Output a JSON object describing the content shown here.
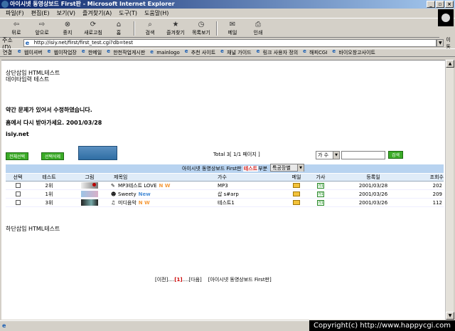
{
  "window": {
    "title": "아이시넷 동영상보드 First판 - Microsoft Internet Explorer",
    "controls": [
      "_",
      "▫",
      "×"
    ]
  },
  "menu": [
    "파일(F)",
    "편집(E)",
    "보기(V)",
    "즐겨찾기(A)",
    "도구(T)",
    "도움말(H)"
  ],
  "toolbar": {
    "buttons": [
      {
        "label": "뒤로",
        "icon": "back-arrow-icon",
        "glyph": "⇦"
      },
      {
        "label": "앞으로",
        "icon": "forward-arrow-icon",
        "glyph": "⇨"
      },
      {
        "label": "중지",
        "icon": "stop-icon",
        "glyph": "⊗"
      },
      {
        "label": "새로고침",
        "icon": "refresh-icon",
        "glyph": "⟳"
      },
      {
        "label": "홈",
        "icon": "home-icon",
        "glyph": "⌂"
      },
      {
        "label": "검색",
        "icon": "search-icon",
        "glyph": "⌕"
      },
      {
        "label": "즐겨찾기",
        "icon": "favorites-icon",
        "glyph": "★"
      },
      {
        "label": "목록보기",
        "icon": "history-icon",
        "glyph": "◷"
      },
      {
        "label": "메일",
        "icon": "mail-icon",
        "glyph": "✉"
      },
      {
        "label": "인쇄",
        "icon": "print-icon",
        "glyph": "⎙"
      }
    ]
  },
  "address": {
    "label": "주소(D)",
    "url": "http://isiy.net/first/first_test.cgi?db=test",
    "go": "이동"
  },
  "links": {
    "label": "연결",
    "items": [
      "웹이셔버",
      "웹이작업장",
      "한메일",
      "한천작업게시판",
      "mainlogo",
      "추천 사이트",
      "채널 가이드",
      "링크 사용자 정의",
      "해피CGI",
      "바이오창고사이트"
    ]
  },
  "content": {
    "top_line1": "상단삽입 HTML테스트",
    "top_line2": "데이타입력 테스트",
    "notice1": "약간 문제가 있어서 수정하였습니다.",
    "notice2": "홈에서 다시 받아가세요. 2001/03/28",
    "site": "isiy.net",
    "btn_select_all": "전체선택",
    "btn_delete": "선택삭제",
    "total": "Total 3[ 1/1 페이지 ]",
    "search_field": "가 수",
    "search_btn": "검색",
    "board_title_pre": "아이시넷 동영상보드 First판 ",
    "board_title_hl": "테스트",
    "board_title_post": "부분",
    "genre_select": "특공장별",
    "bottom_text": "하단삽입 HTML테스트"
  },
  "table": {
    "headers": [
      "선택",
      "테스트",
      "그림",
      "제목임",
      "가수",
      "메일",
      "가사",
      "등록일",
      "조회수"
    ],
    "rows": [
      {
        "rank": "2위",
        "title": "MP3테스트 LOVE",
        "tag": "N  W",
        "singer": "MP3",
        "date": "2001/03/28",
        "views": "202",
        "icon": "music-note-icon"
      },
      {
        "rank": "1위",
        "title": "Sweety",
        "tag": "New",
        "singer": "삽 s#arp",
        "date": "2001/03/26",
        "views": "209",
        "icon": "people-icon"
      },
      {
        "rank": "3위",
        "title": "미디음악",
        "tag": "N  W",
        "singer": "테스트1",
        "date": "2001/03/26",
        "views": "112",
        "icon": "midi-file-icon"
      }
    ],
    "lyric_label": "가1"
  },
  "pager": {
    "prev": "[이전]",
    "sep": "....",
    "current": "[1]",
    "next": "[다음]",
    "board_link": "[아이시넷 동영상보드 First판]"
  },
  "copyright": "Copyright(c) http://www.happycgi.com",
  "colors": {
    "titlebar": "#0a246a",
    "button_green": "#3bab27",
    "board_header": "#b8d3f0",
    "highlight_red": "#d12020"
  }
}
